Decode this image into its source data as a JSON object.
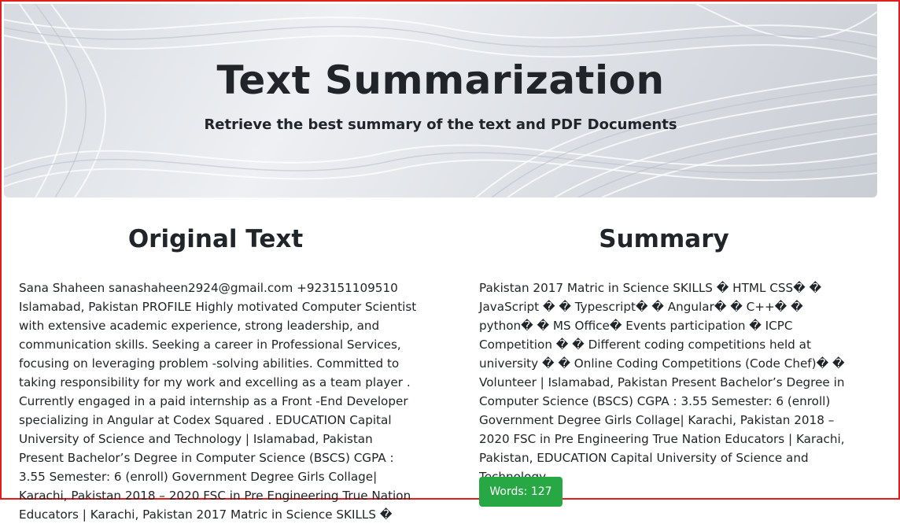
{
  "header": {
    "title": "Text Summarization",
    "subtitle": "Retrieve the best summary of the text and PDF Documents"
  },
  "original": {
    "heading": "Original Text",
    "text": "Sana Shaheen sanashaheen2924@gmail.com +923151109510 Islamabad, Pakistan PROFILE Highly motivated Computer Scientist with extensive academic experience, strong leadership, and communication skills. Seeking a career in Professional Services, focusing on leveraging problem -solving abilities. Committed to taking responsibility for my work and excelling as a team player . Currently engaged in a paid internship as a Front -End Developer specializing in Angular at Codex Squared . EDUCATION Capital University of Science and Technology | Islamabad, Pakistan Present Bachelor’s Degree in Computer Science (BSCS) CGPA : 3.55 Semester: 6 (enroll) Government Degree Girls Collage| Karachi, Pakistan 2018 – 2020 FSC in Pre Engineering True Nation Educators | Karachi, Pakistan 2017 Matric in Science SKILLS �"
  },
  "summary": {
    "heading": "Summary",
    "text": "Pakistan 2017 Matric in Science SKILLS � HTML CSS� � JavaScript � � Typescript� � Angular� � C++� � python� � MS Office� Events participation � ICPC Competition � � Different coding competitions held at university � � Online Coding Competitions (Code Chef)� � Volunteer | Islamabad, Pakistan Present Bachelor’s Degree in Computer Science (BSCS) CGPA : 3.55 Semester: 6 (enroll) Government Degree Girls Collage| Karachi, Pakistan 2018 – 2020 FSC in Pre Engineering True Nation Educators | Karachi, Pakistan, EDUCATION Capital University of Science and Technology",
    "word_count": "Words: 127",
    "badge_color": "#28a745"
  }
}
